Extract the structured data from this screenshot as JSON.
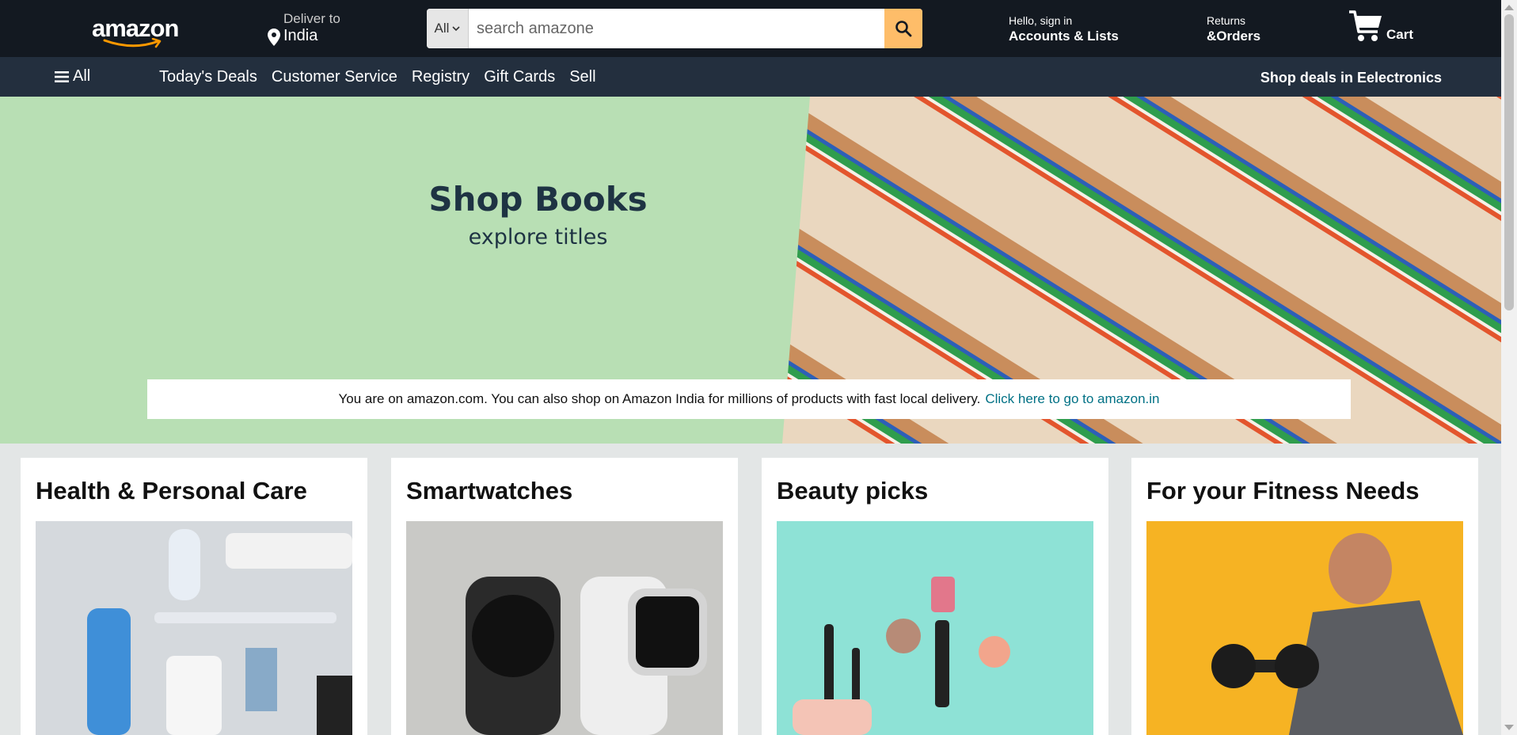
{
  "header": {
    "logo_text": "amazon",
    "deliver_label": "Deliver to",
    "deliver_location": "India",
    "search_category": "All",
    "search_placeholder": "search amazone",
    "account_greeting": "Hello, sign in",
    "account_label": "Accounts & Lists",
    "returns_line1": "Returns",
    "returns_line2": "&Orders",
    "cart_label": "Cart"
  },
  "nav": {
    "all_label": "All",
    "links": [
      "Today's Deals",
      "Customer Service",
      "Registry",
      "Gift Cards",
      "Sell"
    ],
    "deals_label": "Shop deals in Eelectronics"
  },
  "hero": {
    "title": "Shop Books",
    "subtitle": "explore titles",
    "notice_text": "You are on amazon.com. You can also shop on Amazon India for millions of products with fast local delivery.",
    "notice_link": "Click here to go to amazon.in"
  },
  "cards": [
    {
      "title": "Health & Personal Care"
    },
    {
      "title": "Smartwatches"
    },
    {
      "title": "Beauty picks"
    },
    {
      "title": "For your Fitness Needs"
    }
  ],
  "icons": [
    "map-pin-icon",
    "chevron-down-icon",
    "search-icon",
    "cart-icon",
    "hamburger-menu-icon"
  ],
  "colors": {
    "header_bg": "#131921",
    "nav_bg": "#232f3e",
    "search_button": "#febd69",
    "hero_bg": "#b8dfb4",
    "link": "#007185",
    "page_bg": "#e3e6e6"
  }
}
